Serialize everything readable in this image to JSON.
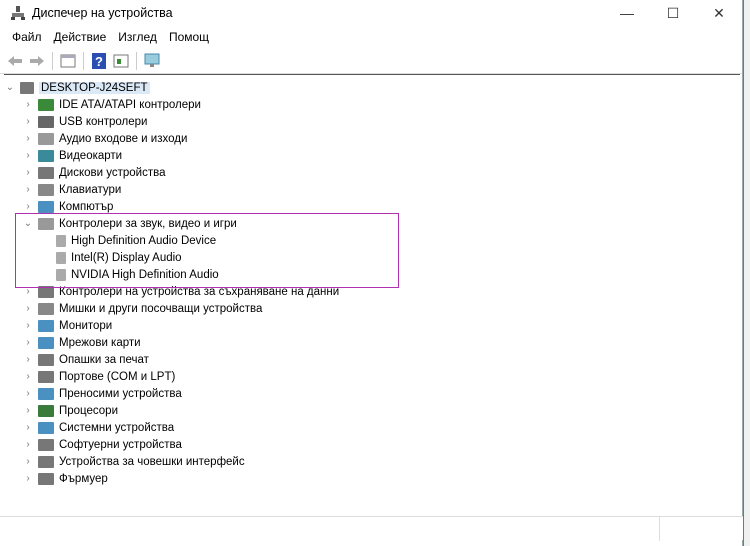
{
  "window": {
    "title": "Диспечер на устройства",
    "minimize": "—",
    "maximize": "☐",
    "close": "✕"
  },
  "menu": [
    "Файл",
    "Действие",
    "Изглед",
    "Помощ"
  ],
  "toolbar": [
    "back-icon",
    "forward-icon",
    "properties-icon",
    "help-icon",
    "view-icon",
    "monitor-icon"
  ],
  "tree": {
    "root": "DESKTOP-J24SEFT",
    "items": [
      {
        "label": "IDE ATA/ATAPI контролери",
        "icon": "ide-icon",
        "color": "#3a8a3a",
        "expanded": false
      },
      {
        "label": "USB контролери",
        "icon": "usb-icon",
        "color": "#666666",
        "expanded": false
      },
      {
        "label": "Аудио входове и изходи",
        "icon": "speaker-icon",
        "color": "#999999",
        "expanded": false
      },
      {
        "label": "Видеокарти",
        "icon": "display-adapter-icon",
        "color": "#3a8a9a",
        "expanded": false
      },
      {
        "label": "Дискови устройства",
        "icon": "disk-icon",
        "color": "#777777",
        "expanded": false
      },
      {
        "label": "Клавиатури",
        "icon": "keyboard-icon",
        "color": "#888888",
        "expanded": false
      },
      {
        "label": "Компютър",
        "icon": "computer-icon",
        "color": "#4a90c0",
        "expanded": false
      },
      {
        "label": "Контролери за звук, видео и игри",
        "icon": "speaker-icon",
        "color": "#999999",
        "expanded": true,
        "children": [
          "High Definition Audio Device",
          "Intel(R) Display Audio",
          "NVIDIA High Definition Audio"
        ]
      },
      {
        "label": "Контролери на устройства за съхраняване на данни",
        "icon": "storage-icon",
        "color": "#777777",
        "expanded": false
      },
      {
        "label": "Мишки и други посочващи устройства",
        "icon": "mouse-icon",
        "color": "#888888",
        "expanded": false
      },
      {
        "label": "Монитори",
        "icon": "monitor-icon",
        "color": "#4a90c0",
        "expanded": false
      },
      {
        "label": "Мрежови карти",
        "icon": "network-icon",
        "color": "#4a90c0",
        "expanded": false
      },
      {
        "label": "Опашки за печат",
        "icon": "printer-icon",
        "color": "#777777",
        "expanded": false
      },
      {
        "label": "Портове (COM и LPT)",
        "icon": "port-icon",
        "color": "#777777",
        "expanded": false
      },
      {
        "label": "Преносими устройства",
        "icon": "portable-device-icon",
        "color": "#4a90c0",
        "expanded": false
      },
      {
        "label": "Процесори",
        "icon": "cpu-icon",
        "color": "#3a7a3a",
        "expanded": false
      },
      {
        "label": "Системни устройства",
        "icon": "system-device-icon",
        "color": "#4a90c0",
        "expanded": false
      },
      {
        "label": "Софтуерни устройства",
        "icon": "software-device-icon",
        "color": "#777777",
        "expanded": false
      },
      {
        "label": "Устройства за човешки интерфейс",
        "icon": "hid-icon",
        "color": "#777777",
        "expanded": false
      },
      {
        "label": "Фърмуер",
        "icon": "firmware-icon",
        "color": "#777777",
        "expanded": false
      }
    ]
  }
}
